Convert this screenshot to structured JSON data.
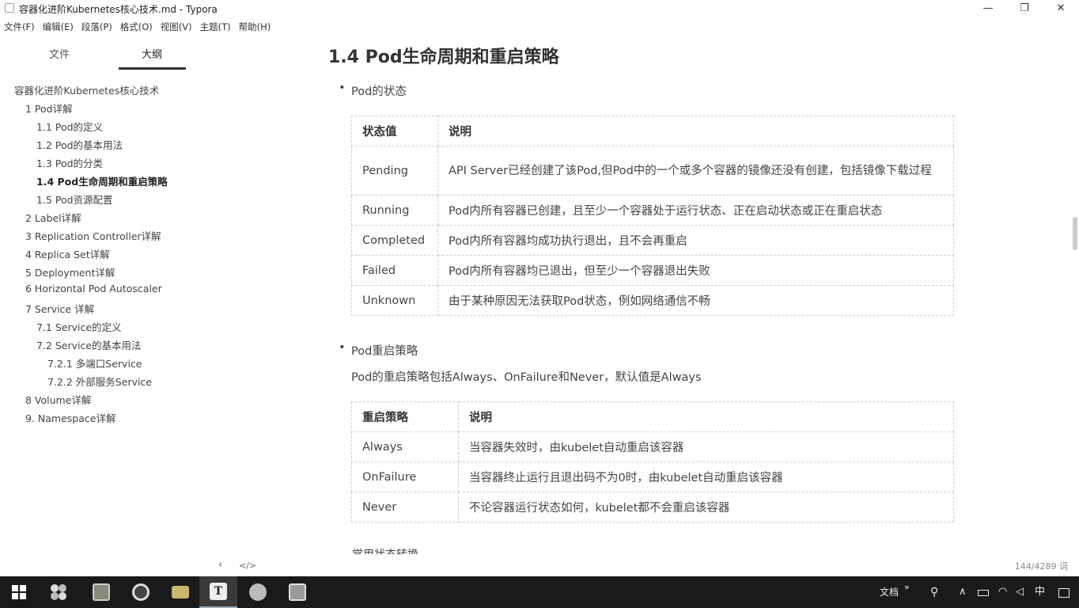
{
  "window": {
    "title": "容器化进阶Kubernetes核心技术.md - Typora",
    "minimize": "—",
    "restore": "❐",
    "close": "✕"
  },
  "menu": [
    "文件(F)",
    "编辑(E)",
    "段落(P)",
    "格式(O)",
    "视图(V)",
    "主题(T)",
    "帮助(H)"
  ],
  "sidebar": {
    "tabs": {
      "files": "文件",
      "outline": "大纲"
    },
    "outline": [
      {
        "text": "容器化进阶Kubernetes核心技术",
        "level": 0
      },
      {
        "text": "1 Pod详解",
        "level": 1
      },
      {
        "text": "1.1 Pod的定义",
        "level": 2
      },
      {
        "text": "1.2 Pod的基本用法",
        "level": 2
      },
      {
        "text": "1.3 Pod的分类",
        "level": 2
      },
      {
        "text": "1.4 Pod生命周期和重启策略",
        "level": 2,
        "active": true
      },
      {
        "text": "1.5 Pod资源配置",
        "level": 2
      },
      {
        "text": "2 Label详解",
        "level": 1
      },
      {
        "text": "3 Replication Controller详解",
        "level": 1
      },
      {
        "text": "4 Replica Set详解",
        "level": 1
      },
      {
        "text": "5 Deployment详解",
        "level": 1
      },
      {
        "text": "6 Horizontal Pod Autoscaler",
        "level": 1
      },
      {
        "text": "7 Service 详解",
        "level": 1
      },
      {
        "text": "7.1 Service的定义",
        "level": 2
      },
      {
        "text": "7.2 Service的基本用法",
        "level": 2
      },
      {
        "text": "7.2.1 多端口Service",
        "level": 3
      },
      {
        "text": "7.2.2 外部服务Service",
        "level": 3
      },
      {
        "text": "8 Volume详解",
        "level": 1
      },
      {
        "text": "9. Namespace详解",
        "level": 1
      }
    ],
    "back_icon": "‹",
    "source_icon": "</>"
  },
  "status": {
    "wordcount": "144/4289 词"
  },
  "content": {
    "heading": "1.4 Pod生命周期和重启策略",
    "bullet1": "Pod的状态",
    "table1": {
      "headers": [
        "状态值",
        "说明"
      ],
      "rows": [
        [
          "Pending",
          "API Server已经创建了该Pod,但Pod中的一个或多个容器的镜像还没有创建，包括镜像下载过程"
        ],
        [
          "Running",
          "Pod内所有容器已创建，且至少一个容器处于运行状态、正在启动状态或正在重启状态"
        ],
        [
          "Completed",
          "Pod内所有容器均成功执行退出，且不会再重启"
        ],
        [
          "Failed",
          "Pod内所有容器均已退出，但至少一个容器退出失败"
        ],
        [
          "Unknown",
          "由于某种原因无法获取Pod状态，例如网络通信不畅"
        ]
      ]
    },
    "bullet2": "Pod重启策略",
    "para2": "Pod的重启策略包括Always、OnFailure和Never，默认值是Always",
    "table2": {
      "headers": [
        "重启策略",
        "说明"
      ],
      "rows": [
        [
          "Always",
          "当容器失效时，由kubelet自动重启该容器"
        ],
        [
          "OnFailure",
          "当容器终止运行且退出码不为0时，由kubelet自动重启该容器"
        ],
        [
          "Never",
          "不论容器运行状态如何，kubelet都不会重启该容器"
        ]
      ]
    },
    "cut_line": "常用状态转换"
  },
  "taskbar": {
    "tray_doc": "文档",
    "tray_more": "»",
    "tray_ime": "中",
    "tray_icons": [
      "person-icon",
      "up-arrow-icon",
      "battery-icon",
      "wifi-icon",
      "volume-icon"
    ]
  }
}
